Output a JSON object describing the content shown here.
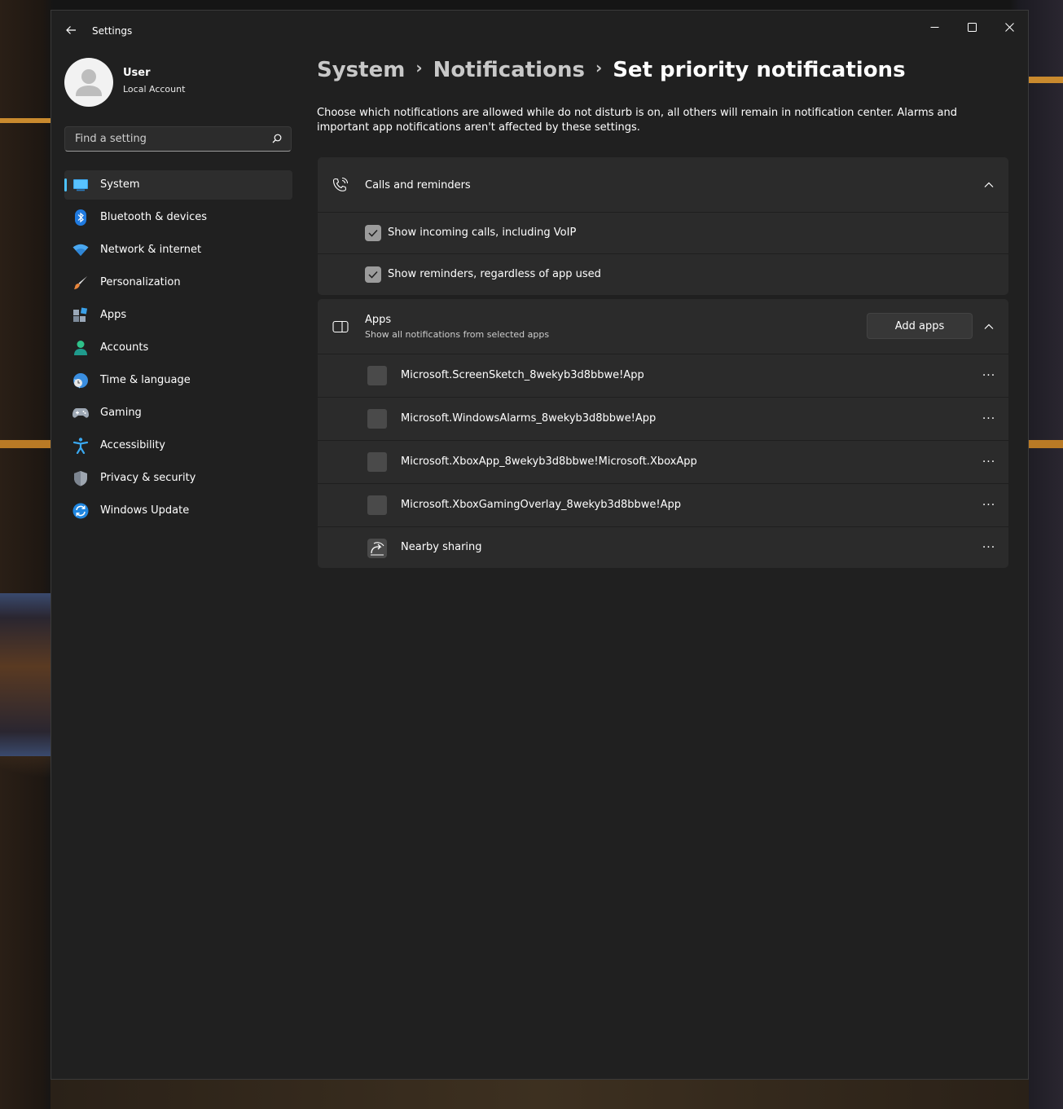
{
  "window": {
    "title": "Settings"
  },
  "profile": {
    "name": "User",
    "account_type": "Local Account"
  },
  "search": {
    "placeholder": "Find a setting"
  },
  "nav": {
    "items": [
      {
        "label": "System",
        "icon": "system-icon",
        "active": true
      },
      {
        "label": "Bluetooth & devices",
        "icon": "bluetooth-icon"
      },
      {
        "label": "Network & internet",
        "icon": "wifi-icon"
      },
      {
        "label": "Personalization",
        "icon": "brush-icon"
      },
      {
        "label": "Apps",
        "icon": "apps-icon"
      },
      {
        "label": "Accounts",
        "icon": "accounts-icon"
      },
      {
        "label": "Time & language",
        "icon": "globe-clock-icon"
      },
      {
        "label": "Gaming",
        "icon": "gamepad-icon"
      },
      {
        "label": "Accessibility",
        "icon": "accessibility-icon"
      },
      {
        "label": "Privacy & security",
        "icon": "shield-icon"
      },
      {
        "label": "Windows Update",
        "icon": "update-icon"
      }
    ]
  },
  "breadcrumb": {
    "level1": "System",
    "level2": "Notifications",
    "current": "Set priority notifications"
  },
  "description": "Choose which notifications are allowed while do not disturb is on, all others will remain in notification center. Alarms and important app notifications aren't affected by these settings.",
  "calls": {
    "title": "Calls and reminders",
    "icon": "phone-ring-icon",
    "expanded": true,
    "options": [
      {
        "label": "Show incoming calls, including VoIP",
        "checked": true
      },
      {
        "label": "Show reminders, regardless of app used",
        "checked": true
      }
    ]
  },
  "apps_section": {
    "title": "Apps",
    "subtitle": "Show all notifications from selected apps",
    "icon": "app-window-icon",
    "add_button": "Add apps",
    "expanded": true,
    "apps": [
      {
        "name": "Microsoft.ScreenSketch_8wekyb3d8bbwe!App",
        "more": "···"
      },
      {
        "name": "Microsoft.WindowsAlarms_8wekyb3d8bbwe!App",
        "more": "···"
      },
      {
        "name": "Microsoft.XboxApp_8wekyb3d8bbwe!Microsoft.XboxApp",
        "more": "···"
      },
      {
        "name": "Microsoft.XboxGamingOverlay_8wekyb3d8bbwe!App",
        "more": "···"
      },
      {
        "name": "Nearby sharing",
        "icon": "nearby-sharing-icon",
        "more": "···"
      }
    ]
  },
  "colors": {
    "accent": "#4cc2ff",
    "window_bg": "#202020",
    "card_bg": "#2b2b2b"
  }
}
